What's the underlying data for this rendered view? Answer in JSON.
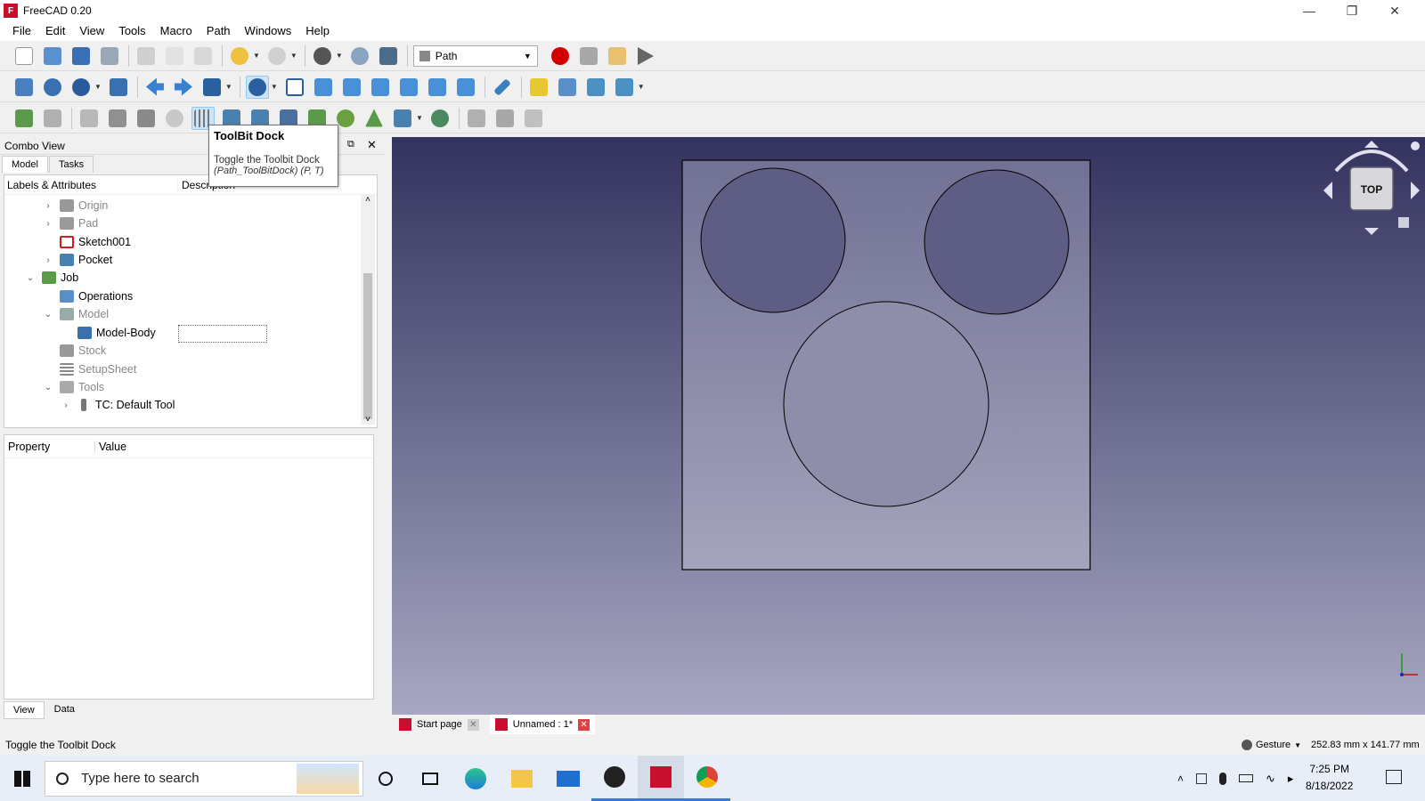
{
  "window": {
    "title": "FreeCAD 0.20"
  },
  "menu": [
    "File",
    "Edit",
    "View",
    "Tools",
    "Macro",
    "Path",
    "Windows",
    "Help"
  ],
  "workbench": {
    "selected": "Path"
  },
  "tooltip": {
    "title": "ToolBit Dock",
    "line1": "Toggle the Toolbit Dock",
    "line2": "(Path_ToolBitDock) (P, T)"
  },
  "combo": {
    "title": "Combo View",
    "tabs": [
      "Model",
      "Tasks"
    ],
    "col_labels": "Labels & Attributes",
    "col_desc": "Description"
  },
  "tree": [
    {
      "label": "Origin",
      "expander": "›",
      "greyed": true
    },
    {
      "label": "Pad",
      "expander": "›",
      "greyed": true
    },
    {
      "label": "Sketch001",
      "expander": "",
      "greyed": false
    },
    {
      "label": "Pocket",
      "expander": "›",
      "greyed": false
    },
    {
      "label": "Job",
      "expander": "⌄",
      "greyed": false
    },
    {
      "label": "Operations",
      "expander": "",
      "greyed": false
    },
    {
      "label": "Model",
      "expander": "⌄",
      "greyed": true
    },
    {
      "label": "Model-Body",
      "expander": "",
      "greyed": false
    },
    {
      "label": "Stock",
      "expander": "",
      "greyed": true
    },
    {
      "label": "SetupSheet",
      "expander": "",
      "greyed": true
    },
    {
      "label": "Tools",
      "expander": "⌄",
      "greyed": true
    },
    {
      "label": "TC: Default Tool",
      "expander": "›",
      "greyed": false
    }
  ],
  "property": {
    "col_property": "Property",
    "col_value": "Value",
    "tabs": [
      "View",
      "Data"
    ]
  },
  "doc_tabs": [
    {
      "label": "Start page"
    },
    {
      "label": "Unnamed : 1*"
    }
  ],
  "navcube": {
    "face": "TOP"
  },
  "status": {
    "message": "Toggle the Toolbit Dock",
    "nav_style": "Gesture",
    "dimensions": "252.83 mm x 141.77 mm"
  },
  "taskbar": {
    "search_placeholder": "Type here to search",
    "time": "7:25 PM",
    "date": "8/18/2022"
  },
  "colors": {
    "viewport_top": "#33335f",
    "viewport_bottom": "#a7a7c2",
    "record": "#d40000"
  }
}
